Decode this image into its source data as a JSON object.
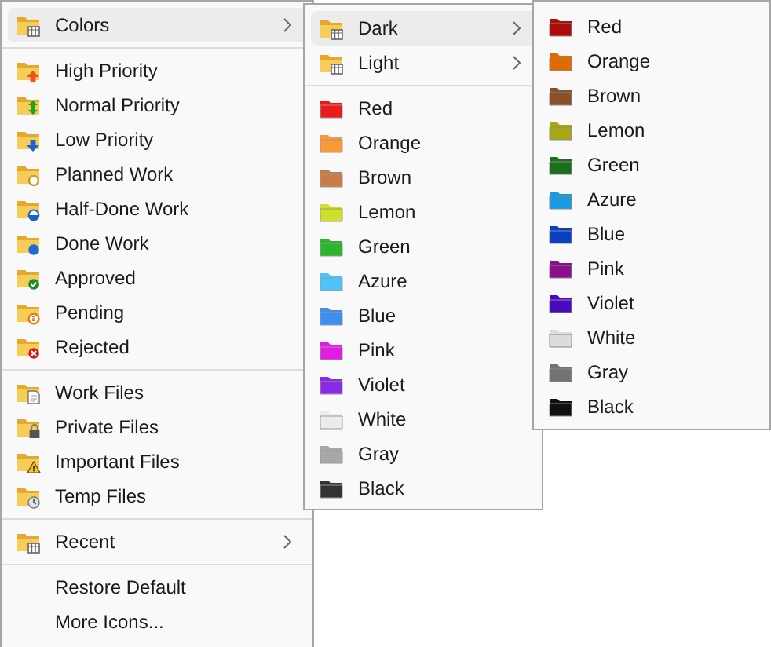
{
  "main_menu": {
    "sections": [
      [
        {
          "label": "Colors",
          "kind": "folder",
          "has_submenu": true,
          "highlighted": true
        }
      ],
      [
        {
          "label": "High Priority",
          "kind": "folder",
          "has_submenu": false,
          "highlighted": false
        },
        {
          "label": "Normal Priority",
          "kind": "folder",
          "has_submenu": false,
          "highlighted": false
        },
        {
          "label": "Low Priority",
          "kind": "folder",
          "has_submenu": false,
          "highlighted": false
        },
        {
          "label": "Planned Work",
          "kind": "folder",
          "has_submenu": false,
          "highlighted": false
        },
        {
          "label": "Half-Done Work",
          "kind": "folder",
          "has_submenu": false,
          "highlighted": false
        },
        {
          "label": "Done Work",
          "kind": "folder",
          "has_submenu": false,
          "highlighted": false
        },
        {
          "label": "Approved",
          "kind": "folder",
          "has_submenu": false,
          "highlighted": false
        },
        {
          "label": "Pending",
          "kind": "folder",
          "has_submenu": false,
          "highlighted": false
        },
        {
          "label": "Rejected",
          "kind": "folder",
          "has_submenu": false,
          "highlighted": false
        }
      ],
      [
        {
          "label": "Work Files",
          "kind": "folder",
          "has_submenu": false,
          "highlighted": false
        },
        {
          "label": "Private Files",
          "kind": "folder",
          "has_submenu": false,
          "highlighted": false
        },
        {
          "label": "Important Files",
          "kind": "folder",
          "has_submenu": false,
          "highlighted": false
        },
        {
          "label": "Temp Files",
          "kind": "folder",
          "has_submenu": false,
          "highlighted": false
        }
      ],
      [
        {
          "label": "Recent",
          "kind": "folder",
          "has_submenu": true,
          "highlighted": false
        }
      ],
      [
        {
          "label": "Restore Default",
          "kind": "plain",
          "has_submenu": false,
          "highlighted": false
        },
        {
          "label": "More Icons...",
          "kind": "plain",
          "has_submenu": false,
          "highlighted": false
        }
      ]
    ]
  },
  "colors_menu": {
    "groups": [
      {
        "label": "Dark",
        "highlighted": true
      },
      {
        "label": "Light",
        "highlighted": false
      }
    ],
    "items": [
      {
        "label": "Red",
        "color": "#e81b1b"
      },
      {
        "label": "Orange",
        "color": "#f99a3a"
      },
      {
        "label": "Brown",
        "color": "#c97c45"
      },
      {
        "label": "Lemon",
        "color": "#cfdf29"
      },
      {
        "label": "Green",
        "color": "#2eb52e"
      },
      {
        "label": "Azure",
        "color": "#4fc3f7"
      },
      {
        "label": "Blue",
        "color": "#3c8ef0"
      },
      {
        "label": "Pink",
        "color": "#e21de2"
      },
      {
        "label": "Violet",
        "color": "#8a2be2"
      },
      {
        "label": "White",
        "color": "#ececec"
      },
      {
        "label": "Gray",
        "color": "#a8a8a8"
      },
      {
        "label": "Black",
        "color": "#333333"
      }
    ]
  },
  "dark_menu": {
    "items": [
      {
        "label": "Red",
        "color": "#b00c0c"
      },
      {
        "label": "Orange",
        "color": "#e06b00"
      },
      {
        "label": "Brown",
        "color": "#8b4f2a"
      },
      {
        "label": "Lemon",
        "color": "#a8a815"
      },
      {
        "label": "Green",
        "color": "#1d6e1d"
      },
      {
        "label": "Azure",
        "color": "#1a9be0"
      },
      {
        "label": "Blue",
        "color": "#0a3fc0"
      },
      {
        "label": "Pink",
        "color": "#8c0f8c"
      },
      {
        "label": "Violet",
        "color": "#4a0bc0"
      },
      {
        "label": "White",
        "color": "#dcdcdc"
      },
      {
        "label": "Gray",
        "color": "#737373"
      },
      {
        "label": "Black",
        "color": "#111111"
      }
    ]
  }
}
